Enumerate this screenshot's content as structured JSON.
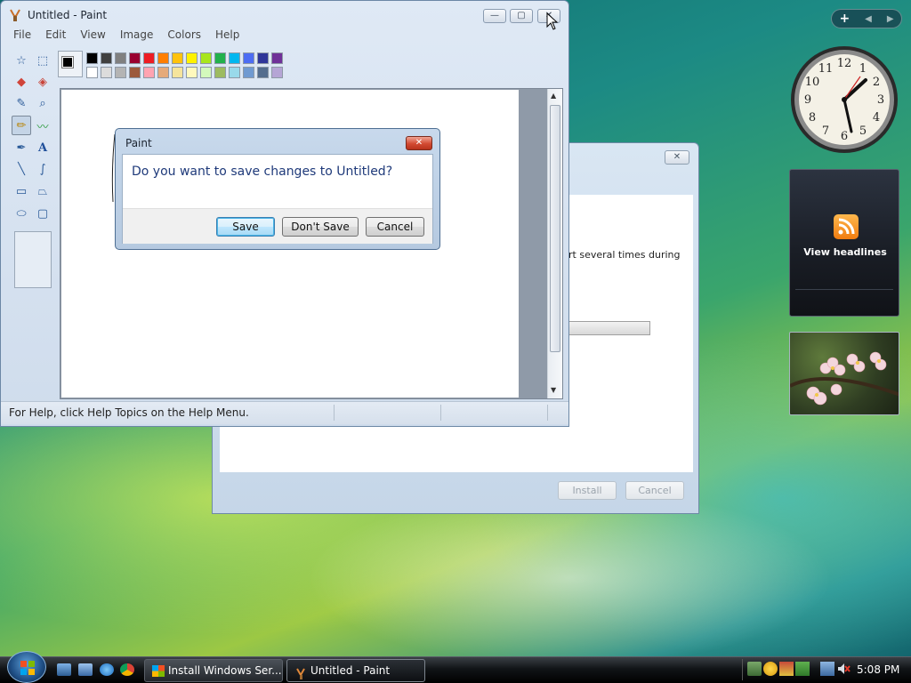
{
  "paint": {
    "title": "Untitled - Paint",
    "menu": [
      "File",
      "Edit",
      "View",
      "Image",
      "Colors",
      "Help"
    ],
    "status": "For Help, click Help Topics on the Help Menu.",
    "palette_top": [
      "#000000",
      "#404040",
      "#808080",
      "#990030",
      "#ed1c24",
      "#ff7e00",
      "#ffc20e",
      "#fff200",
      "#a8e61d",
      "#22b14c",
      "#00b7ef",
      "#4d6df3",
      "#2f3699",
      "#6f3198"
    ],
    "palette_bottom": [
      "#ffffff",
      "#dcdcdc",
      "#b4b4b4",
      "#9c5a3c",
      "#ffa3b1",
      "#e5aa7a",
      "#f5e49c",
      "#fff9bd",
      "#d3f9bc",
      "#9dbb61",
      "#99d9ea",
      "#709ad1",
      "#546d8e",
      "#b5a5d5"
    ],
    "tools": [
      "free-select-icon",
      "rect-select-icon",
      "eraser-icon",
      "fill-icon",
      "color-picker-icon",
      "magnifier-icon",
      "pencil-icon",
      "brush-icon",
      "airbrush-icon",
      "text-icon",
      "line-icon",
      "curve-icon",
      "rectangle-icon",
      "polygon-icon",
      "ellipse-icon",
      "rounded-rect-icon"
    ]
  },
  "dialog": {
    "title": "Paint",
    "question": "Do you want to save changes to Untitled?",
    "save": "Save",
    "dont_save": "Don't Save",
    "cancel": "Cancel"
  },
  "installer": {
    "text_fragment": "rt several times during",
    "install": "Install",
    "cancel": "Cancel"
  },
  "sidebar": {
    "headlines_label": "View headlines"
  },
  "taskbar": {
    "tasks": [
      {
        "label": "Install Windows Ser..."
      },
      {
        "label": "Untitled - Paint"
      }
    ],
    "time": "5:08 PM"
  }
}
